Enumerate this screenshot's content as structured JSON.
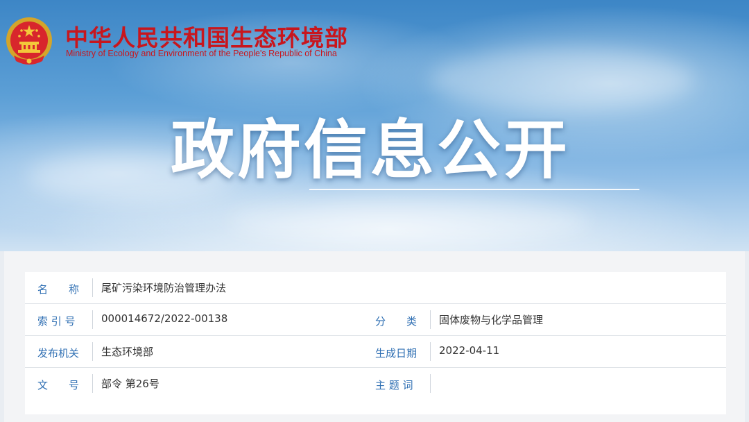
{
  "header": {
    "org_name_cn": "中华人民共和国生态环境部",
    "org_name_en": "Ministry of Ecology and Environment of the People's Republic of China",
    "hero_title": "政府信息公开"
  },
  "colors": {
    "brand_red": "#c8161d",
    "label_blue": "#2f6fb3"
  },
  "info": {
    "name_label": "名　　称",
    "name_value": "尾矿污染环境防治管理办法",
    "index_label": "索 引 号",
    "index_value": "000014672/2022-00138",
    "category_label": "分　　类",
    "category_value": "固体废物与化学品管理",
    "issuer_label": "发布机关",
    "issuer_value": "生态环境部",
    "date_label": "生成日期",
    "date_value": "2022-04-11",
    "doc_no_label": "文　　号",
    "doc_no_value": "部令 第26号",
    "keywords_label": "主 题 词",
    "keywords_value": ""
  }
}
